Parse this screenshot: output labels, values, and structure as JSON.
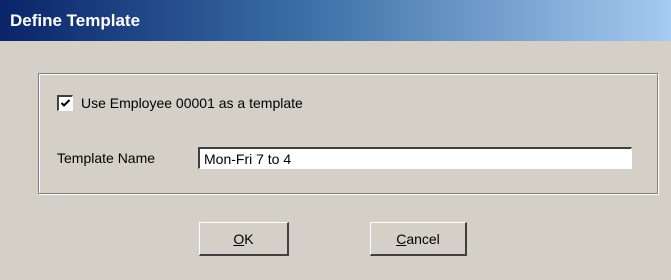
{
  "window": {
    "title": "Define Template"
  },
  "options": {
    "use_template_checked": true,
    "use_template_label": "Use Employee 00001 as a template"
  },
  "template_name": {
    "label": "Template Name",
    "value": "Mon-Fri 7 to 4"
  },
  "buttons": {
    "ok_mnemonic": "O",
    "ok_rest": "K",
    "cancel_mnemonic": "C",
    "cancel_rest": "ancel"
  },
  "colors": {
    "titlebar_start": "#0a246a",
    "titlebar_end": "#a6caf0",
    "dialog_face": "#d4d0c8"
  }
}
